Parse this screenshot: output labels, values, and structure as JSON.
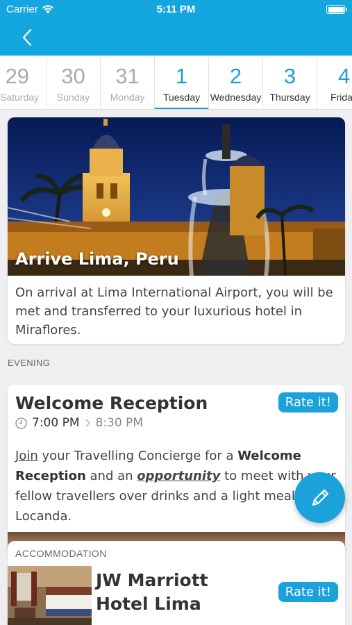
{
  "status_bar": {
    "carrier": "Carrier",
    "time": "5:11 PM"
  },
  "nav": {
    "back_icon": "chevron-left-icon"
  },
  "days": [
    {
      "num": "29",
      "name": "Saturday",
      "state": "past"
    },
    {
      "num": "30",
      "name": "Sunday",
      "state": "past"
    },
    {
      "num": "31",
      "name": "Monday",
      "state": "past"
    },
    {
      "num": "1",
      "name": "Tuesday",
      "state": "active"
    },
    {
      "num": "2",
      "name": "Wednesday",
      "state": "future"
    },
    {
      "num": "3",
      "name": "Thursday",
      "state": "future"
    },
    {
      "num": "4",
      "name": "Friday",
      "state": "future"
    }
  ],
  "arrival": {
    "title": "Arrive Lima, Peru",
    "description": "On arrival at Lima International Airport, you will be met and transferred to your luxurious hotel in Miraflores."
  },
  "section_label": "EVENING",
  "event": {
    "title": "Welcome Reception",
    "rate_label": "Rate it!",
    "start_time": "7:00 PM",
    "end_time": "8:30 PM",
    "desc": {
      "join": "Join",
      "part1": " your Travelling Concierge for a ",
      "bold1": "Welcome Reception",
      "part2": " and an ",
      "bold2": "opportunity",
      "part3": " to meet with your fellow travellers over drinks and a light meal at La Locanda."
    }
  },
  "accommodation": {
    "label": "ACCOMMODATION",
    "hotel_name": "JW Marriott Hotel Lima",
    "rate_label": "Rate it!"
  },
  "fab": {
    "icon": "pencil-icon"
  },
  "colors": {
    "brand": "#14a6de",
    "accent": "#1d9fd6"
  }
}
